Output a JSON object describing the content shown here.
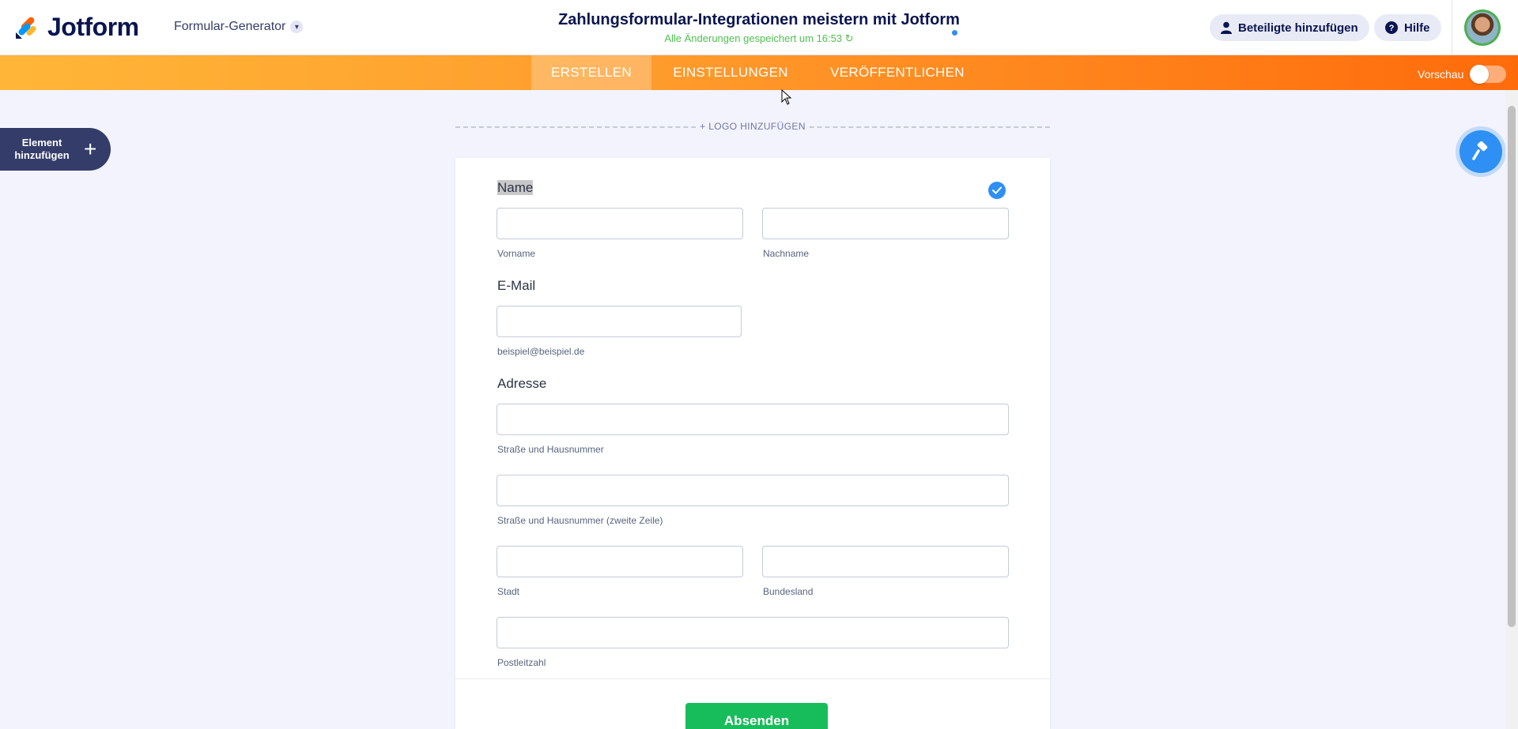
{
  "header": {
    "logo_text": "Jotform",
    "builder_label": "Formular-Generator",
    "form_title": "Zahlungsformular-Integrationen meistern mit Jotform",
    "save_status": "Alle Änderungen gespeichert um 16:53",
    "collaborators_label": "Beteiligte hinzufügen",
    "help_label": "Hilfe"
  },
  "nav": {
    "tabs": [
      {
        "label": "ERSTELLEN",
        "active": true
      },
      {
        "label": "EINSTELLUNGEN",
        "active": false
      },
      {
        "label": "VERÖFFENTLICHEN",
        "active": false
      }
    ],
    "preview_label": "Vorschau",
    "preview_on": false
  },
  "sidebar": {
    "add_element_line1": "Element",
    "add_element_line2": "hinzufügen"
  },
  "form": {
    "logo_placeholder": "+ LOGO HINZUFÜGEN",
    "name": {
      "label": "Name",
      "first_sublabel": "Vorname",
      "last_sublabel": "Nachname"
    },
    "email": {
      "label": "E-Mail",
      "sublabel": "beispiel@beispiel.de"
    },
    "address": {
      "label": "Adresse",
      "street_sublabel": "Straße und Hausnummer",
      "street2_sublabel": "Straße und Hausnummer (zweite Zeile)",
      "city_sublabel": "Stadt",
      "state_sublabel": "Bundesland",
      "zip_sublabel": "Postleitzahl"
    },
    "submit_label": "Absenden"
  },
  "colors": {
    "accent_orange": "#ff6100",
    "primary_blue": "#2e8ff5",
    "submit_green": "#18bd5b",
    "navy": "#0a1551"
  }
}
